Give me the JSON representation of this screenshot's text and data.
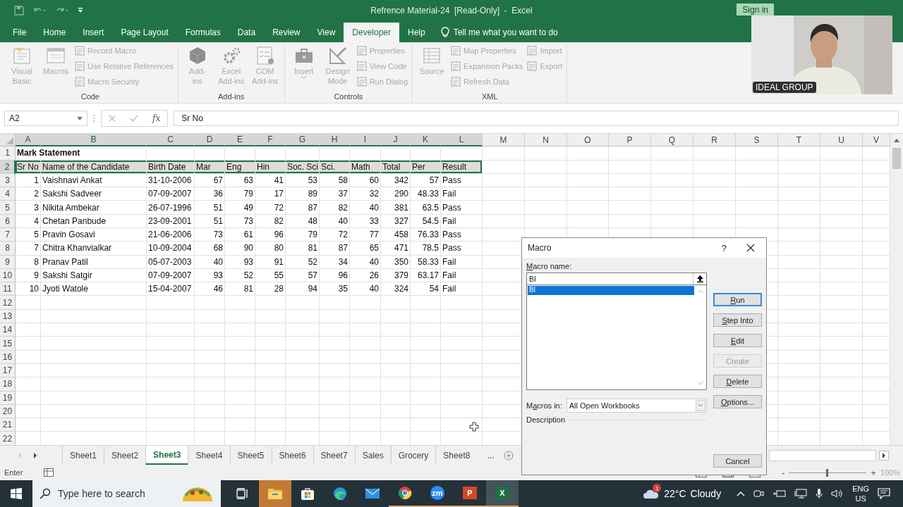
{
  "title_bar": {
    "title": "Refrence Material-24  [Read-Only]  -  Excel",
    "sign_in": "Sign in"
  },
  "menu_tabs": [
    {
      "label": "File",
      "selected": false
    },
    {
      "label": "Home",
      "selected": false
    },
    {
      "label": "Insert",
      "selected": false
    },
    {
      "label": "Page Layout",
      "selected": false
    },
    {
      "label": "Formulas",
      "selected": false
    },
    {
      "label": "Data",
      "selected": false
    },
    {
      "label": "Review",
      "selected": false
    },
    {
      "label": "View",
      "selected": false
    },
    {
      "label": "Developer",
      "selected": true
    },
    {
      "label": "Help",
      "selected": false
    }
  ],
  "tell_me": {
    "placeholder": "Tell me what you want to do"
  },
  "ribbon": {
    "groups": [
      {
        "name": "Code",
        "large": [
          {
            "lines": [
              "Visual",
              "Basic"
            ],
            "disabled": true
          },
          {
            "lines": [
              "Macros"
            ],
            "disabled": true
          }
        ],
        "small_columns": [
          [
            {
              "label": "Record Macro",
              "disabled": true
            },
            {
              "label": "Use Relative References",
              "disabled": true
            },
            {
              "label": "Macro Security",
              "disabled": true
            }
          ]
        ]
      },
      {
        "name": "Add-ins",
        "large": [
          {
            "lines": [
              "Add-",
              "ins"
            ],
            "disabled": true
          },
          {
            "lines": [
              "Excel",
              "Add-ins"
            ],
            "disabled": true
          },
          {
            "lines": [
              "COM",
              "Add-ins"
            ],
            "disabled": true
          }
        ]
      },
      {
        "name": "Controls",
        "large": [
          {
            "lines": [
              "Insert"
            ],
            "disabled": true,
            "dropdown": true
          },
          {
            "lines": [
              "Design",
              "Mode"
            ],
            "disabled": true
          }
        ],
        "small_columns": [
          [
            {
              "label": "Properties",
              "disabled": true
            },
            {
              "label": "View Code",
              "disabled": true
            },
            {
              "label": "Run Dialog",
              "disabled": true
            }
          ]
        ]
      },
      {
        "name": "XML",
        "large": [
          {
            "lines": [
              "Source"
            ],
            "disabled": true
          }
        ],
        "small_columns": [
          [
            {
              "label": "Map Properties",
              "disabled": true
            },
            {
              "label": "Expansion Packs",
              "disabled": true
            },
            {
              "label": "Refresh Data",
              "disabled": true
            }
          ],
          [
            {
              "label": "Import",
              "disabled": true
            },
            {
              "label": "Export",
              "disabled": true
            }
          ]
        ]
      }
    ]
  },
  "formula_bar": {
    "name_box": "A2",
    "function_label": "fx",
    "formula": "Sr No"
  },
  "sheet": {
    "columns": [
      {
        "letter": "A",
        "numeric": true
      },
      {
        "letter": "B",
        "numeric": false
      },
      {
        "letter": "C",
        "numeric": false
      },
      {
        "letter": "D",
        "numeric": true
      },
      {
        "letter": "E",
        "numeric": true
      },
      {
        "letter": "F",
        "numeric": true
      },
      {
        "letter": "G",
        "numeric": true
      },
      {
        "letter": "H",
        "numeric": true
      },
      {
        "letter": "I",
        "numeric": true
      },
      {
        "letter": "J",
        "numeric": true
      },
      {
        "letter": "K",
        "numeric": true
      },
      {
        "letter": "L",
        "numeric": false
      },
      {
        "letter": "M"
      },
      {
        "letter": "N"
      },
      {
        "letter": "O"
      },
      {
        "letter": "P"
      },
      {
        "letter": "Q"
      },
      {
        "letter": "R"
      },
      {
        "letter": "S"
      },
      {
        "letter": "T"
      },
      {
        "letter": "U"
      },
      {
        "letter": "V"
      }
    ],
    "rows": [
      {
        "number": "1",
        "kind": "title",
        "selected": false,
        "cells": [
          "Mark Statement"
        ]
      },
      {
        "number": "2",
        "kind": "header",
        "selected": true,
        "cells": [
          "Sr No",
          "Name of the Candidate",
          "Birth Date",
          "Mar",
          "Eng",
          "Hin",
          "Soc. Sci",
          "Sci.",
          "Math",
          "Total",
          "Per",
          "Result"
        ]
      },
      {
        "number": "3",
        "kind": "record",
        "selected": false,
        "cells": [
          "1",
          "Vaishnavi Ankat",
          "31-10-2006",
          "67",
          "63",
          "41",
          "53",
          "58",
          "60",
          "342",
          "57",
          "Pass"
        ]
      },
      {
        "number": "4",
        "kind": "record",
        "selected": false,
        "cells": [
          "2",
          "Sakshi Sadveer",
          "07-09-2007",
          "36",
          "79",
          "17",
          "89",
          "37",
          "32",
          "290",
          "48.33",
          "Fail"
        ]
      },
      {
        "number": "5",
        "kind": "record",
        "selected": false,
        "cells": [
          "3",
          "Nikita  Ambekar",
          "26-07-1996",
          "51",
          "49",
          "72",
          "87",
          "82",
          "40",
          "381",
          "63.5",
          "Pass"
        ]
      },
      {
        "number": "6",
        "kind": "record",
        "selected": false,
        "cells": [
          "4",
          "Chetan Panbude",
          "23-09-2001",
          "51",
          "73",
          "82",
          "48",
          "40",
          "33",
          "327",
          "54.5",
          "Fail"
        ]
      },
      {
        "number": "7",
        "kind": "record",
        "selected": false,
        "cells": [
          "5",
          "Pravin  Gosavi",
          "21-06-2006",
          "73",
          "61",
          "96",
          "79",
          "72",
          "77",
          "458",
          "76.33",
          "Pass"
        ]
      },
      {
        "number": "8",
        "kind": "record",
        "selected": false,
        "cells": [
          "7",
          "Chitra Khanvialkar",
          "10-09-2004",
          "68",
          "90",
          "80",
          "81",
          "87",
          "65",
          "471",
          "78.5",
          "Pass"
        ]
      },
      {
        "number": "9",
        "kind": "record",
        "selected": false,
        "cells": [
          "8",
          "Pranav Patil",
          "05-07-2003",
          "40",
          "93",
          "91",
          "52",
          "34",
          "40",
          "350",
          "58.33",
          "Fail"
        ]
      },
      {
        "number": "10",
        "kind": "record",
        "selected": false,
        "cells": [
          "9",
          "Sakshi Satgir",
          "07-09-2007",
          "93",
          "52",
          "55",
          "57",
          "96",
          "26",
          "379",
          "63.17",
          "Fail"
        ]
      },
      {
        "number": "11",
        "kind": "record",
        "selected": false,
        "cells": [
          "10",
          "Jyoti Watole",
          "15-04-2007",
          "46",
          "81",
          "28",
          "94",
          "35",
          "40",
          "324",
          "54",
          "Fail"
        ]
      },
      {
        "number": "12",
        "kind": "empty",
        "selected": false
      },
      {
        "number": "13",
        "kind": "empty",
        "selected": false
      },
      {
        "number": "14",
        "kind": "empty",
        "selected": false
      },
      {
        "number": "15",
        "kind": "empty",
        "selected": false
      },
      {
        "number": "16",
        "kind": "empty",
        "selected": false
      },
      {
        "number": "17",
        "kind": "empty",
        "selected": false
      },
      {
        "number": "18",
        "kind": "empty",
        "selected": false
      },
      {
        "number": "19",
        "kind": "empty",
        "selected": false
      },
      {
        "number": "20",
        "kind": "empty",
        "selected": false
      },
      {
        "number": "21",
        "kind": "empty",
        "selected": false
      },
      {
        "number": "22",
        "kind": "empty",
        "selected": false
      }
    ]
  },
  "sheet_tabs": {
    "tabs": [
      {
        "label": "Sheet1",
        "selected": false
      },
      {
        "label": "Sheet2",
        "selected": false
      },
      {
        "label": "Sheet3",
        "selected": true
      },
      {
        "label": "Sheet4",
        "selected": false
      },
      {
        "label": "Sheet5",
        "selected": false
      },
      {
        "label": "Sheet6",
        "selected": false
      },
      {
        "label": "Sheet7",
        "selected": false
      },
      {
        "label": "Sales",
        "selected": false
      },
      {
        "label": "Grocery",
        "selected": false
      },
      {
        "label": "Sheet8",
        "selected": false
      }
    ],
    "more": "..."
  },
  "status_bar": {
    "mode": "Enter",
    "zoom": {
      "minus": "-",
      "plus": "+",
      "level": 0.5,
      "reading": "100%"
    }
  },
  "macro_dialog": {
    "title": "Macro",
    "help": "?",
    "name_label": {
      "key": "M",
      "after": "acro name:"
    },
    "name_value": "Bl",
    "macros": [
      {
        "name": "Bl",
        "selected": true
      }
    ],
    "macros_in_label": {
      "before": "M",
      "key": "a",
      "after": "cros in:"
    },
    "macros_in_value": "All Open Workbooks",
    "description_label": "Description",
    "buttons": [
      {
        "key": "R",
        "after": "un",
        "default": true,
        "disabled": false
      },
      {
        "key": "S",
        "after": "tep Into",
        "default": false,
        "disabled": false
      },
      {
        "key": "E",
        "after": "dit",
        "default": false,
        "disabled": false
      },
      {
        "before": "Create",
        "default": false,
        "disabled": true
      },
      {
        "key": "D",
        "after": "elete",
        "default": false,
        "disabled": false
      },
      {
        "key": "O",
        "after": "ptions...",
        "default": false,
        "disabled": false
      }
    ],
    "cancel": "Cancel"
  },
  "webcam": {
    "kind": "picture",
    "caption": "IDEAL GROUP"
  },
  "taskbar": {
    "search": {
      "placeholder": "Type here to search"
    },
    "apps": [
      {
        "kind": "task-view",
        "running": false,
        "flashing": false,
        "active": false
      },
      {
        "kind": "explorer",
        "running": false,
        "flashing": true,
        "active": false
      },
      {
        "kind": "store",
        "running": false,
        "flashing": false,
        "active": false
      },
      {
        "kind": "edge",
        "running": false,
        "flashing": false,
        "active": false
      },
      {
        "kind": "mail",
        "running": false,
        "flashing": false,
        "active": false
      },
      {
        "kind": "chrome",
        "running": true,
        "flashing": false,
        "active": false
      },
      {
        "kind": "zoom",
        "label": "zm",
        "running": true,
        "flashing": false,
        "active": false
      },
      {
        "kind": "powerpoint",
        "label": "P",
        "running": true,
        "flashing": false,
        "active": false
      },
      {
        "kind": "excel",
        "label": "X",
        "running": true,
        "flashing": false,
        "active": true
      }
    ],
    "weather": {
      "badge": "1",
      "temperature": "22°C",
      "condition": "Cloudy"
    },
    "language": {
      "primary": "ENG",
      "secondary": "US"
    }
  }
}
